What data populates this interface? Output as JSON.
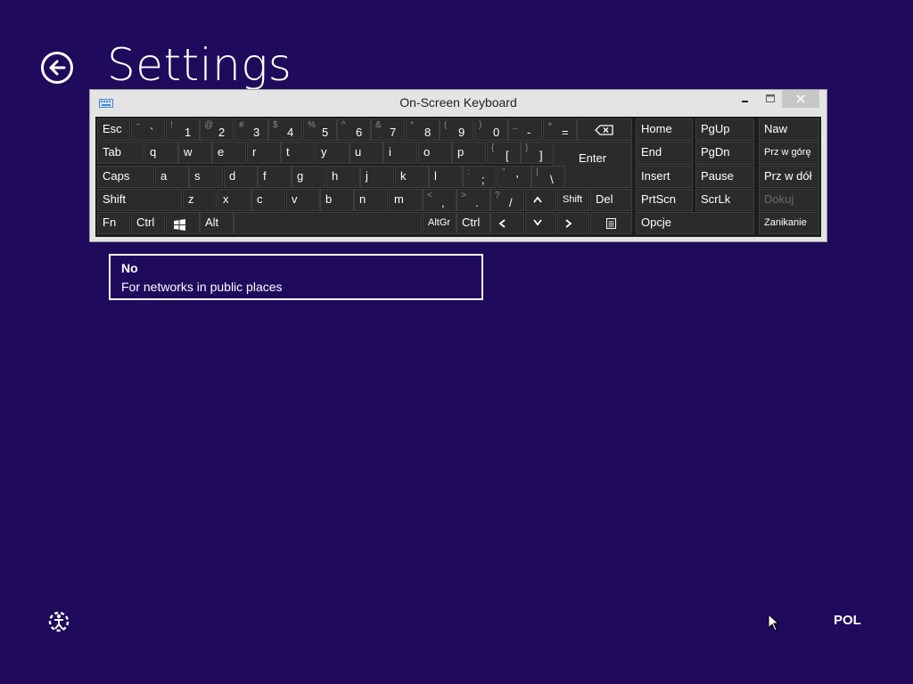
{
  "page": {
    "title": "Settings",
    "back_icon": "back-arrow-icon",
    "background": "#1f0a5c"
  },
  "osk": {
    "title": "On-Screen Keyboard",
    "rows": [
      [
        {
          "label": "Esc"
        },
        {
          "shift": "~",
          "main": "`"
        },
        {
          "shift": "!",
          "main": "1"
        },
        {
          "shift": "@",
          "main": "2"
        },
        {
          "shift": "#",
          "main": "3"
        },
        {
          "shift": "$",
          "main": "4"
        },
        {
          "shift": "%",
          "main": "5"
        },
        {
          "shift": "^",
          "main": "6"
        },
        {
          "shift": "&",
          "main": "7"
        },
        {
          "shift": "*",
          "main": "8"
        },
        {
          "shift": "(",
          "main": "9"
        },
        {
          "shift": ")",
          "main": "0"
        },
        {
          "shift": "_",
          "main": "-"
        },
        {
          "shift": "+",
          "main": "="
        },
        {
          "icon": "backspace-icon"
        }
      ],
      [
        {
          "label": "Tab"
        },
        {
          "label": "q"
        },
        {
          "label": "w"
        },
        {
          "label": "e"
        },
        {
          "label": "r"
        },
        {
          "label": "t"
        },
        {
          "label": "y"
        },
        {
          "label": "u"
        },
        {
          "label": "i"
        },
        {
          "label": "o"
        },
        {
          "label": "p"
        },
        {
          "shift": "{",
          "main": "["
        },
        {
          "shift": "}",
          "main": "]"
        },
        {
          "label": "Enter",
          "center": true
        }
      ],
      [
        {
          "label": "Caps"
        },
        {
          "label": "a"
        },
        {
          "label": "s"
        },
        {
          "label": "d"
        },
        {
          "label": "f"
        },
        {
          "label": "g"
        },
        {
          "label": "h"
        },
        {
          "label": "j"
        },
        {
          "label": "k"
        },
        {
          "label": "l"
        },
        {
          "shift": ":",
          "main": ";"
        },
        {
          "shift": "\"",
          "main": "'"
        },
        {
          "shift": "|",
          "main": "\\"
        }
      ],
      [
        {
          "label": "Shift"
        },
        {
          "label": "z"
        },
        {
          "label": "x"
        },
        {
          "label": "c"
        },
        {
          "label": "v"
        },
        {
          "label": "b"
        },
        {
          "label": "n"
        },
        {
          "label": "m"
        },
        {
          "shift": "<",
          "main": ","
        },
        {
          "shift": ">",
          "main": "."
        },
        {
          "shift": "?",
          "main": "/"
        },
        {
          "icon": "arrow-up-icon"
        },
        {
          "label": "Shift",
          "small": true
        },
        {
          "label": "Del"
        }
      ],
      [
        {
          "label": "Fn"
        },
        {
          "label": "Ctrl"
        },
        {
          "icon": "windows-logo-icon"
        },
        {
          "label": "Alt"
        },
        {
          "label": ""
        },
        {
          "label": "AltGr",
          "small": true
        },
        {
          "label": "Ctrl"
        },
        {
          "icon": "arrow-left-icon"
        },
        {
          "icon": "arrow-down-icon"
        },
        {
          "icon": "arrow-right-icon"
        },
        {
          "icon": "menu-key-icon"
        }
      ]
    ],
    "nav_keys": [
      {
        "label": "Home"
      },
      {
        "label": "PgUp"
      },
      {
        "label": "End"
      },
      {
        "label": "PgDn"
      },
      {
        "label": "Insert"
      },
      {
        "label": "Pause"
      },
      {
        "label": "PrtScn"
      },
      {
        "label": "ScrLk"
      },
      {
        "label": "Opcje"
      }
    ],
    "side_keys": [
      {
        "label": "Naw"
      },
      {
        "label": "Prz w górę",
        "small": true
      },
      {
        "label": "Prz w dół"
      },
      {
        "label": "Dokuj",
        "dim": true
      },
      {
        "label": "Zanikanie",
        "small": true
      }
    ]
  },
  "network_option": {
    "title": "No",
    "subtitle": "For networks in public places"
  },
  "footer": {
    "ease_icon": "ease-of-access-icon",
    "language": "POL"
  }
}
